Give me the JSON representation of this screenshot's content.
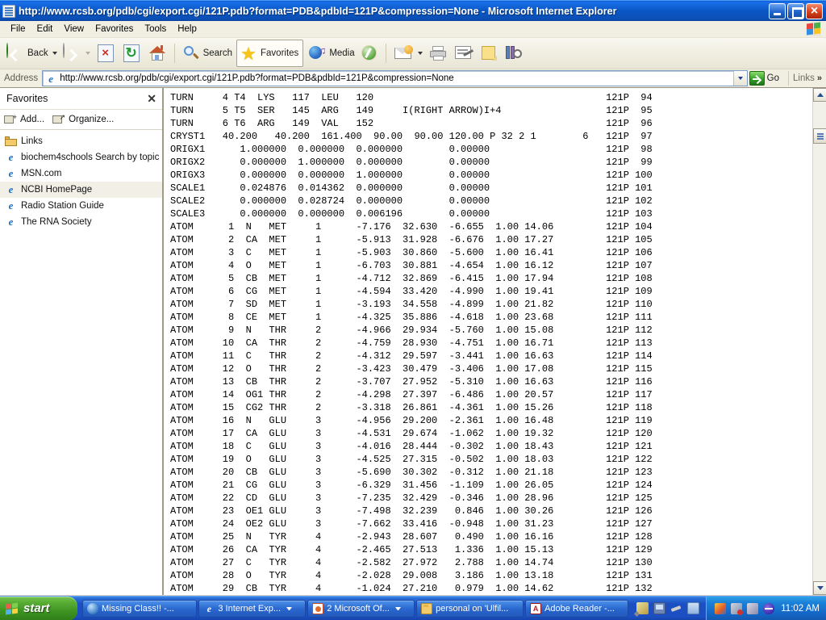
{
  "window": {
    "title": "http://www.rcsb.org/pdb/cgi/export.cgi/121P.pdb?format=PDB&pdbId=121P&compression=None - Microsoft Internet Explorer",
    "title_icon": "page-icon",
    "minimize_label": "Minimize",
    "maximize_label": "Restore",
    "close_label": "Close"
  },
  "menu": {
    "items": [
      {
        "label": "File"
      },
      {
        "label": "Edit"
      },
      {
        "label": "View"
      },
      {
        "label": "Favorites"
      },
      {
        "label": "Tools"
      },
      {
        "label": "Help"
      }
    ],
    "brand_icon": "windows-flag-icon"
  },
  "toolbar": {
    "back_label": "Back",
    "search_label": "Search",
    "favorites_label": "Favorites",
    "media_label": "Media",
    "icons": {
      "back": "back-arrow-icon",
      "forward": "forward-arrow-icon",
      "stop": "stop-icon",
      "refresh": "refresh-icon",
      "home": "home-icon",
      "search": "search-icon",
      "favorites": "star-icon",
      "media": "media-globe-icon",
      "history": "history-compass-icon",
      "mail": "mail-icon",
      "print": "printer-icon",
      "edit": "edit-page-icon",
      "notes": "sticky-note-icon",
      "discuss": "discuss-icon"
    }
  },
  "address": {
    "label": "Address",
    "value": "http://www.rcsb.org/pdb/cgi/export.cgi/121P.pdb?format=PDB&pdbId=121P&compression=None",
    "placeholder": "Address",
    "go_label": "Go",
    "links_label": "Links",
    "overflow_chevron": "»"
  },
  "favorites_pane": {
    "title": "Favorites",
    "close_label": "✕",
    "add_label": "Add...",
    "organize_label": "Organize...",
    "items": [
      {
        "label": "Links",
        "icon": "folder-icon",
        "selected": false
      },
      {
        "label": "biochem4schools Search by topic",
        "icon": "ie-page-icon",
        "selected": false
      },
      {
        "label": "MSN.com",
        "icon": "ie-page-icon",
        "selected": false
      },
      {
        "label": "NCBI HomePage",
        "icon": "ie-page-icon",
        "selected": true
      },
      {
        "label": "Radio Station Guide",
        "icon": "ie-page-icon",
        "selected": false
      },
      {
        "label": "The RNA Society",
        "icon": "ie-page-icon",
        "selected": false
      }
    ]
  },
  "document": {
    "lines": [
      "TURN     4 T4  LYS   117  LEU   120                                        121P  94",
      "TURN     5 T5  SER   145  ARG   149     I(RIGHT ARROW)I+4                  121P  95",
      "TURN     6 T6  ARG   149  VAL   152                                        121P  96",
      "CRYST1   40.200   40.200  161.400  90.00  90.00 120.00 P 32 2 1        6   121P  97",
      "ORIGX1      1.000000  0.000000  0.000000        0.00000                    121P  98",
      "ORIGX2      0.000000  1.000000  0.000000        0.00000                    121P  99",
      "ORIGX3      0.000000  0.000000  1.000000        0.00000                    121P 100",
      "SCALE1      0.024876  0.014362  0.000000        0.00000                    121P 101",
      "SCALE2      0.000000  0.028724  0.000000        0.00000                    121P 102",
      "SCALE3      0.000000  0.000000  0.006196        0.00000                    121P 103",
      "ATOM      1  N   MET     1      -7.176  32.630  -6.655  1.00 14.06         121P 104",
      "ATOM      2  CA  MET     1      -5.913  31.928  -6.676  1.00 17.27         121P 105",
      "ATOM      3  C   MET     1      -5.903  30.860  -5.600  1.00 16.41         121P 106",
      "ATOM      4  O   MET     1      -6.703  30.881  -4.654  1.00 16.12         121P 107",
      "ATOM      5  CB  MET     1      -4.712  32.869  -6.415  1.00 17.94         121P 108",
      "ATOM      6  CG  MET     1      -4.594  33.420  -4.990  1.00 19.41         121P 109",
      "ATOM      7  SD  MET     1      -3.193  34.558  -4.899  1.00 21.82         121P 110",
      "ATOM      8  CE  MET     1      -4.325  35.886  -4.618  1.00 23.68         121P 111",
      "ATOM      9  N   THR     2      -4.966  29.934  -5.760  1.00 15.08         121P 112",
      "ATOM     10  CA  THR     2      -4.759  28.930  -4.751  1.00 16.71         121P 113",
      "ATOM     11  C   THR     2      -4.312  29.597  -3.441  1.00 16.63         121P 114",
      "ATOM     12  O   THR     2      -3.423  30.479  -3.406  1.00 17.08         121P 115",
      "ATOM     13  CB  THR     2      -3.707  27.952  -5.310  1.00 16.63         121P 116",
      "ATOM     14  OG1 THR     2      -4.298  27.397  -6.486  1.00 20.57         121P 117",
      "ATOM     15  CG2 THR     2      -3.318  26.861  -4.361  1.00 15.26         121P 118",
      "ATOM     16  N   GLU     3      -4.956  29.200  -2.361  1.00 16.48         121P 119",
      "ATOM     17  CA  GLU     3      -4.531  29.674  -1.062  1.00 19.32         121P 120",
      "ATOM     18  C   GLU     3      -4.016  28.444  -0.302  1.00 18.43         121P 121",
      "ATOM     19  O   GLU     3      -4.525  27.315  -0.502  1.00 18.03         121P 122",
      "ATOM     20  CB  GLU     3      -5.690  30.302  -0.312  1.00 21.18         121P 123",
      "ATOM     21  CG  GLU     3      -6.329  31.456  -1.109  1.00 26.05         121P 124",
      "ATOM     22  CD  GLU     3      -7.235  32.429  -0.346  1.00 28.96         121P 125",
      "ATOM     23  OE1 GLU     3      -7.498  32.239   0.846  1.00 30.26         121P 126",
      "ATOM     24  OE2 GLU     3      -7.662  33.416  -0.948  1.00 31.23         121P 127",
      "ATOM     25  N   TYR     4      -2.943  28.607   0.490  1.00 16.16         121P 128",
      "ATOM     26  CA  TYR     4      -2.465  27.513   1.336  1.00 15.13         121P 129",
      "ATOM     27  C   TYR     4      -2.582  27.972   2.788  1.00 14.74         121P 130",
      "ATOM     28  O   TYR     4      -2.028  29.008   3.186  1.00 13.18         121P 131",
      "ATOM     29  CB  TYR     4      -1.024  27.210   0.979  1.00 14.62         121P 132"
    ]
  },
  "scrollbar": {
    "up_label": "Scroll up",
    "down_label": "Scroll down",
    "thumb_label": "Scroll thumb"
  },
  "taskbar": {
    "start_label": "start",
    "buttons": [
      {
        "label": "Missing Class!! -...",
        "icon": "outlook-icon",
        "has_dropdown": false
      },
      {
        "label": "3 Internet Exp...",
        "icon": "ie-icon",
        "has_dropdown": true
      },
      {
        "label": "2 Microsoft Of...",
        "icon": "powerpoint-icon",
        "has_dropdown": true
      },
      {
        "label": "personal on 'Ulfil...",
        "icon": "folder-icon",
        "has_dropdown": false
      },
      {
        "label": "Adobe Reader -...",
        "icon": "acrobat-icon",
        "has_dropdown": false
      }
    ],
    "quick_icons": [
      "pen-icon",
      "screen-icon",
      "brush-icon",
      "tablet-flag-icon"
    ],
    "tray_icons": [
      "shield-icon",
      "network-error-icon",
      "volume-icon",
      "wave-icon"
    ],
    "clock": "11:02 AM"
  }
}
